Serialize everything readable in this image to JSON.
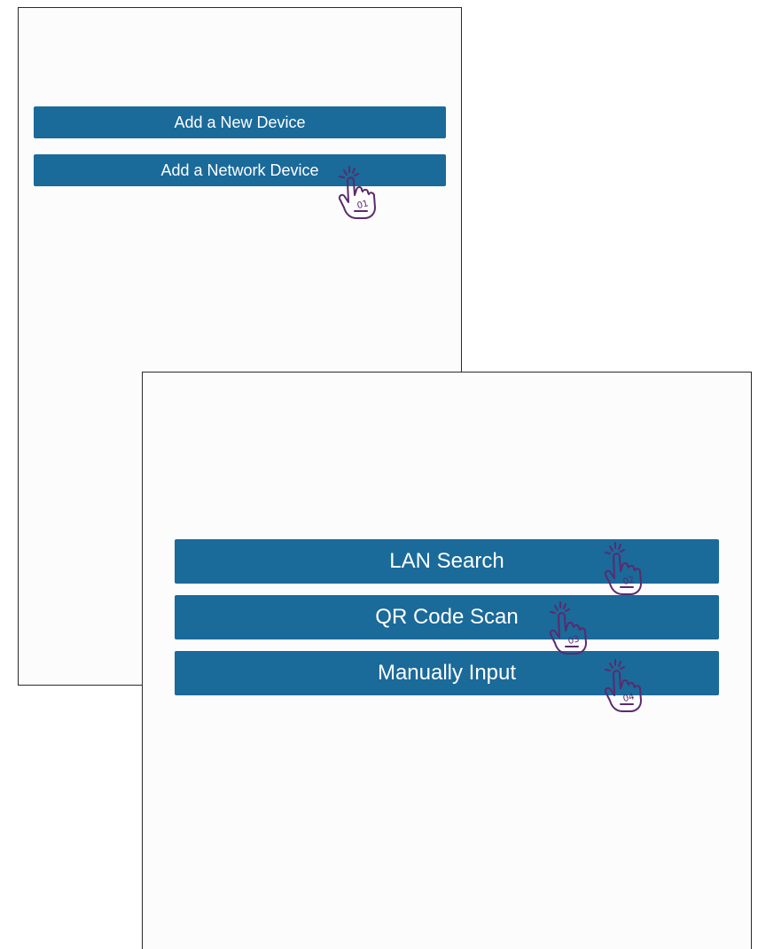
{
  "screen_one": {
    "buttons": [
      {
        "label": "Add a New Device"
      },
      {
        "label": "Add a Network Device"
      }
    ]
  },
  "screen_two": {
    "buttons": [
      {
        "label": "LAN Search"
      },
      {
        "label": "QR Code Scan"
      },
      {
        "label": "Manually Input"
      }
    ]
  },
  "tap_markers": [
    {
      "step": "01",
      "icon": "tap-hand-icon"
    },
    {
      "step": "02",
      "icon": "tap-hand-icon"
    },
    {
      "step": "03",
      "icon": "tap-hand-icon"
    },
    {
      "step": "04",
      "icon": "tap-hand-icon"
    }
  ],
  "colors": {
    "button_bg": "#1a6a9a",
    "button_text": "#ffffff",
    "marker": "#5b2a6e",
    "screen_bg": "#fcfcfc"
  }
}
